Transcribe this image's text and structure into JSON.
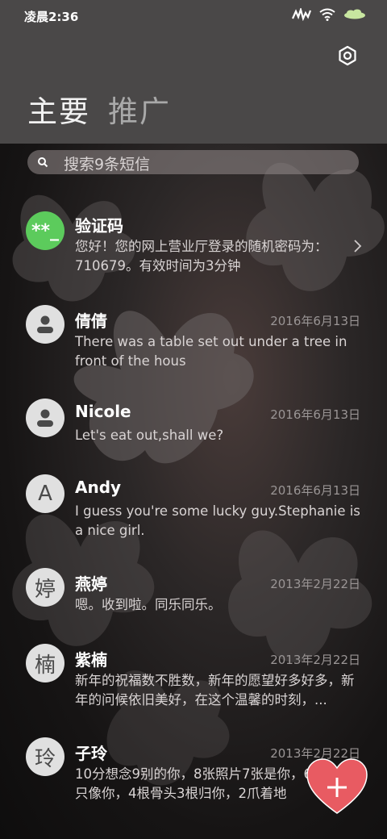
{
  "status_bar": {
    "time": "凌晨2:36"
  },
  "tabs": [
    {
      "label": "主要"
    },
    {
      "label": "推广"
    }
  ],
  "search": {
    "placeholder": "搜索9条短信"
  },
  "conversations": [
    {
      "avatar": "**_",
      "name": "验证码",
      "date": "",
      "message": "您好！您的网上营业厅登录的随机密码为：710679。有效时间为3分钟"
    },
    {
      "avatar": "person",
      "name": "倩倩",
      "date": "2016年6月13日",
      "message": "There was a table set out under a tree in front of the hous"
    },
    {
      "avatar": "person",
      "name": "Nicole",
      "date": "2016年6月13日",
      "message": "Let's eat out,shall we?"
    },
    {
      "avatar": "A",
      "name": "Andy",
      "date": "2016年6月13日",
      "message": "I guess you're some lucky guy.Stephanie is a nice girl."
    },
    {
      "avatar": "婷",
      "name": "燕婷",
      "date": "2013年2月22日",
      "message": "嗯。收到啦。同乐同乐。"
    },
    {
      "avatar": "楠",
      "name": "紫楠",
      "date": "2013年2月22日",
      "message": "新年的祝福数不胜数，新年的愿望好多好多，新年的问候依旧美好，在这个温馨的时刻，..."
    },
    {
      "avatar": "玲",
      "name": "子玲",
      "date": "2013年2月22日",
      "message": "10分想念9别的你，8张照片7张是你，6只小狗5只像你，4根骨头3根归你，2爪着地"
    }
  ],
  "colors": {
    "header": "#4a4848",
    "avatar_green": "#5ccb5c",
    "fab": "#e85b62"
  },
  "icons": [
    "signal-icon",
    "wifi-icon",
    "battery-icon",
    "settings-icon",
    "search-icon",
    "chevron-right-icon",
    "person-icon",
    "compose-heart-icon"
  ]
}
